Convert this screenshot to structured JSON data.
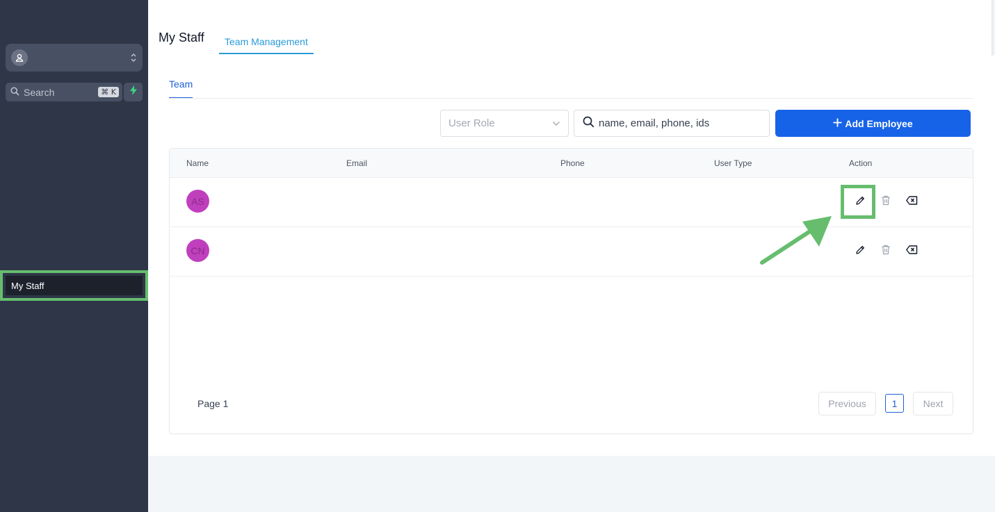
{
  "sidebar": {
    "search_label": "Search",
    "search_shortcut": "⌘ K",
    "nav_items": [
      {
        "label": "My Staff"
      }
    ]
  },
  "header": {
    "title": "My Staff",
    "tab": "Team Management"
  },
  "content": {
    "subtab": "Team",
    "role_select_placeholder": "User Role",
    "search_placeholder": "name, email, phone, ids",
    "add_button_label": "Add Employee"
  },
  "table": {
    "columns": [
      "Name",
      "Email",
      "Phone",
      "User Type",
      "Action"
    ],
    "rows": [
      {
        "initials": "AS",
        "email": "",
        "phone": "",
        "user_type": ""
      },
      {
        "initials": "CN",
        "email": "",
        "phone": "",
        "user_type": ""
      }
    ],
    "action_icons": [
      "pencil-icon",
      "trash-icon",
      "backspace-icon"
    ]
  },
  "pagination": {
    "label": "Page 1",
    "previous": "Previous",
    "current_page": "1",
    "next": "Next"
  },
  "colors": {
    "sidebar_bg": "#2e3647",
    "accent_blue": "#1763e8",
    "tab_blue": "#2a9ad8",
    "avatar_bg": "#c03fbd",
    "highlight_green": "#67bd6e"
  }
}
